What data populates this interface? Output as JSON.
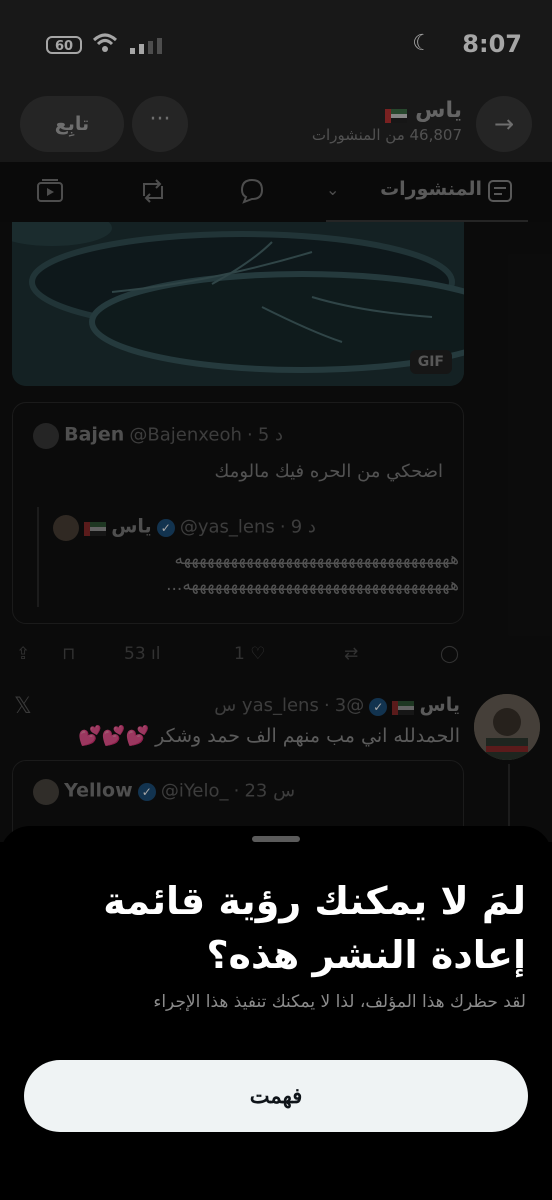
{
  "status_bar": {
    "time": "8:07",
    "battery": "60"
  },
  "header": {
    "name": "ياس",
    "posts_count": "46,807 من المنشورات",
    "follow_label": "تابِع",
    "more_label": "···",
    "back_label": "→"
  },
  "tabs": {
    "posts_label": "المنشورات"
  },
  "timeline": {
    "gif_badge": "GIF",
    "quote": {
      "name": "Bajen",
      "handle": "@Bajenxeoh",
      "time": "5 د",
      "text": "اضحكي من الحره فيك مالومك",
      "inner": {
        "name": "ياس",
        "handle": "@yas_lens",
        "time": "9 د",
        "line1": "هههههههههههههههههههههههههههههههههههه",
        "line2": "ههههههههههههههههههههههههههههههههههه..."
      }
    },
    "actions": {
      "views": "53",
      "likes": "1"
    },
    "tweet2": {
      "name": "ياس",
      "handle": "@yas_lens",
      "time": "3 س",
      "text": "الحمدلله اني مب منهم الف حمد وشكر 💕💕💕",
      "quote_name": "Yellow",
      "quote_handle": "@iYelo_",
      "quote_time": "23 س"
    }
  },
  "sheet": {
    "title": "لمَ لا يمكنك رؤية قائمة إعادة النشر هذه؟",
    "message": "لقد حظرك هذا المؤلف، لذا لا يمكنك تنفيذ هذا الإجراء",
    "button_label": "فهمت"
  },
  "colors": {
    "sheet_bg": "#000000",
    "button_bg": "#eff3f4",
    "verified": "#1d9bf0"
  }
}
